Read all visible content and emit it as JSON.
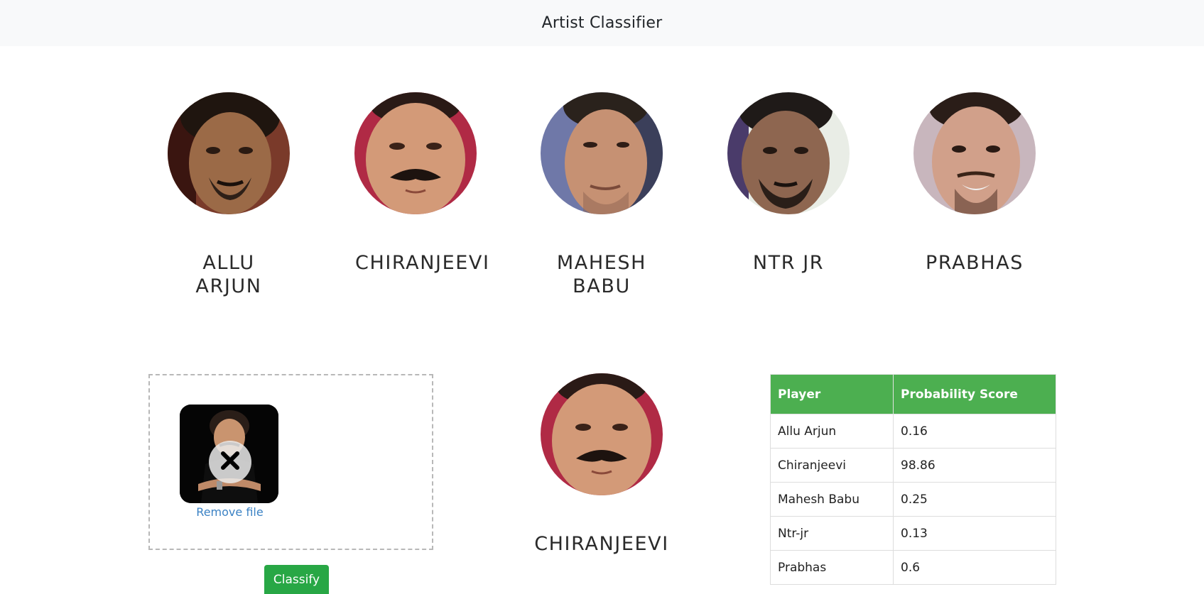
{
  "navbar": {
    "title": "Artist Classifier"
  },
  "artists": [
    {
      "name": "ALLU ARJUN"
    },
    {
      "name": "CHIRANJEEVI"
    },
    {
      "name": "MAHESH BABU"
    },
    {
      "name": "NTR JR"
    },
    {
      "name": "PRABHAS"
    }
  ],
  "upload": {
    "remove_label": "Remove file",
    "classify_label": "Classify"
  },
  "result": {
    "name": "CHIRANJEEVI"
  },
  "table": {
    "headers": [
      "Player",
      "Probability Score"
    ],
    "rows": [
      [
        "Allu Arjun",
        "0.16"
      ],
      [
        "Chiranjeevi",
        "98.86"
      ],
      [
        "Mahesh Babu",
        "0.25"
      ],
      [
        "Ntr-jr",
        "0.13"
      ],
      [
        "Prabhas",
        "0.6"
      ]
    ]
  },
  "colors": {
    "navbar_bg": "#f8f9fa",
    "button_green": "#28a745",
    "table_header_green": "#4caf50",
    "link_blue": "#3b82c4"
  }
}
